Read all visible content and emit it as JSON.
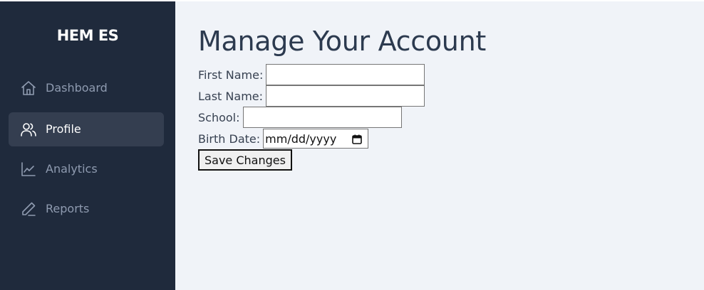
{
  "sidebar": {
    "brand": "HEM ES",
    "items": [
      {
        "label": "Dashboard",
        "icon": "home-icon",
        "active": false
      },
      {
        "label": "Profile",
        "icon": "users-icon",
        "active": true
      },
      {
        "label": "Analytics",
        "icon": "chart-line-icon",
        "active": false
      },
      {
        "label": "Reports",
        "icon": "pencil-icon",
        "active": false
      }
    ]
  },
  "main": {
    "title": "Manage Your Account",
    "form": {
      "first_name_label": "First Name:",
      "first_name_value": "",
      "last_name_label": "Last Name:",
      "last_name_value": "",
      "school_label": "School:",
      "school_value": "",
      "birth_date_label": "Birth Date:",
      "birth_date_placeholder": "mm/dd/yyyy",
      "save_label": "Save Changes"
    }
  },
  "colors": {
    "sidebar_bg": "#1f2a3c",
    "active_item_bg": "#343e50",
    "content_bg": "#f0f3f8",
    "title_text": "#2c3a4f"
  }
}
